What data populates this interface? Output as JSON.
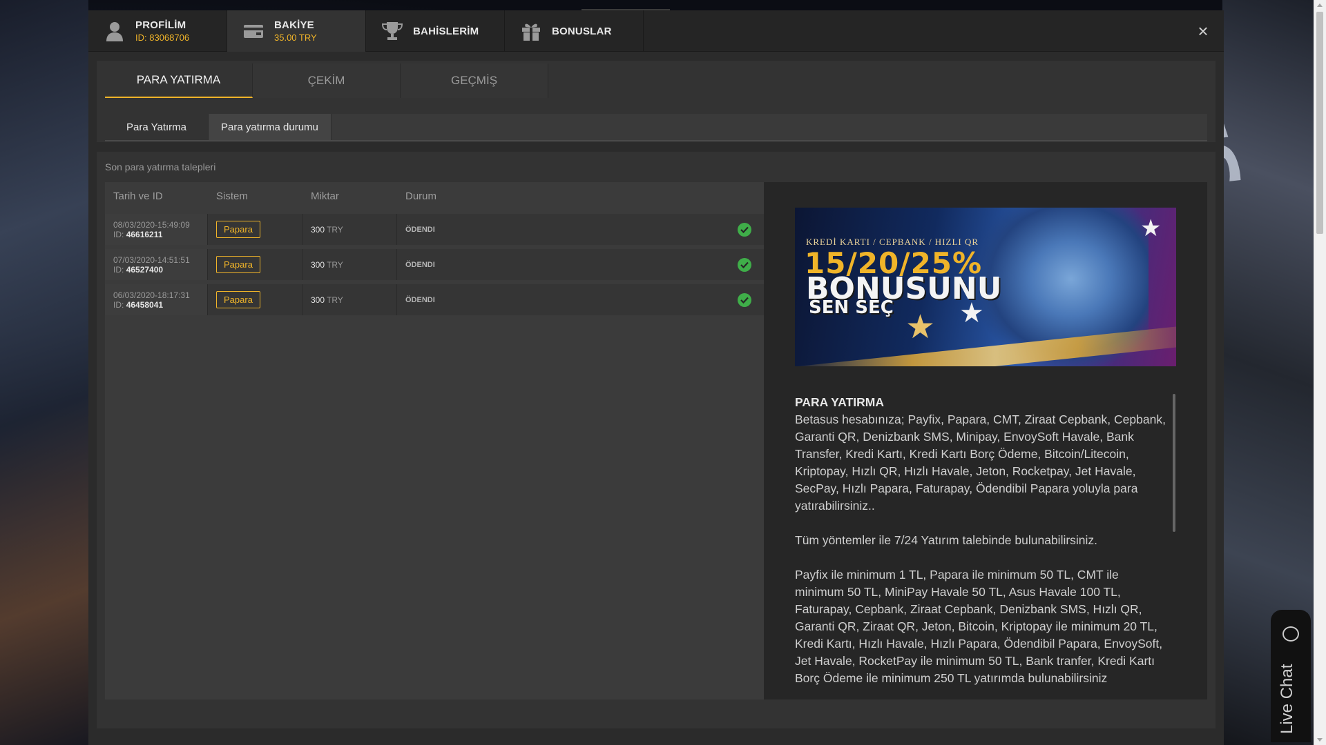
{
  "topbar": {
    "profile": {
      "label": "PROFİLİM",
      "sub": "ID: 83068706"
    },
    "balance": {
      "label": "BAKİYE",
      "sub": "35.00 TRY"
    },
    "bets": {
      "label": "BAHİSLERİM"
    },
    "bonuses": {
      "label": "BONUSLAR"
    },
    "close": "×"
  },
  "main_tabs": [
    {
      "label": "PARA YATIRMA",
      "active": true
    },
    {
      "label": "ÇEKİM",
      "active": false
    },
    {
      "label": "GEÇMİŞ",
      "active": false
    }
  ],
  "sub_tabs": [
    {
      "label": "Para Yatırma",
      "active": false
    },
    {
      "label": "Para yatırma durumu",
      "active": true
    }
  ],
  "list": {
    "caption": "Son para yatırma talepleri",
    "headers": [
      "Tarih ve ID",
      "Sistem",
      "Miktar",
      "Durum"
    ],
    "rows": [
      {
        "date": "08/03/2020-15:49:09",
        "id_prefix": "ID:",
        "id": "46616211",
        "system": "Papara",
        "amount": "300",
        "currency": "TRY",
        "status": "ÖDENDI"
      },
      {
        "date": "07/03/2020-14:51:51",
        "id_prefix": "ID:",
        "id": "46527400",
        "system": "Papara",
        "amount": "300",
        "currency": "TRY",
        "status": "ÖDENDI"
      },
      {
        "date": "06/03/2020-18:17:31",
        "id_prefix": "ID:",
        "id": "46458041",
        "system": "Papara",
        "amount": "300",
        "currency": "TRY",
        "status": "ÖDENDI"
      }
    ]
  },
  "banner": {
    "line1": "KREDİ KARTI / CEPBANK / HIZLI QR",
    "line2": "15/20/25%",
    "line3": "BONUSUNU",
    "line4": "SEN SEÇ"
  },
  "info": {
    "title": "PARA YATIRMA",
    "p1": "Betasus hesabınıza; Payfix, Papara, CMT, Ziraat Cepbank, Cepbank, Garanti QR, Denizbank SMS, Minipay, EnvoySoft Havale, Bank Transfer, Kredi Kartı, Kredi Kartı Borç Ödeme, Bitcoin/Litecoin, Kriptopay, Hızlı QR, Hızlı Havale, Jeton, Rocketpay, Jet Havale, SecPay, Hızlı Papara, Faturapay, Ödendibil Papara yoluyla para yatırabilirsiniz..",
    "p2": "Tüm yöntemler ile 7/24 Yatırım talebinde bulunabilirsiniz.",
    "p3": "Payfix ile minimum 1 TL, Papara ile minimum 50 TL, CMT ile minimum 50 TL, MiniPay Havale 50 TL, Asus Havale 100 TL, Faturapay, Cepbank, Ziraat Cepbank, Denizbank SMS, Hızlı QR, Garanti QR, Ziraat QR, Jeton, Bitcoin, Kriptopay ile minimum 20 TL, Kredi Kartı, Hızlı Havale, Hızlı Papara, Ödendibil Papara, EnvoySoft, Jet Havale, RocketPay ile minimum 50 TL, Bank tranfer, Kredi Kartı Borç Ödeme ile minimum 250 TL yatırımda bulunabilirsiniz"
  },
  "livechat": {
    "label": "Live Chat"
  },
  "colors": {
    "accent": "#f0b429",
    "success": "#3fae49",
    "panel": "#333333"
  }
}
